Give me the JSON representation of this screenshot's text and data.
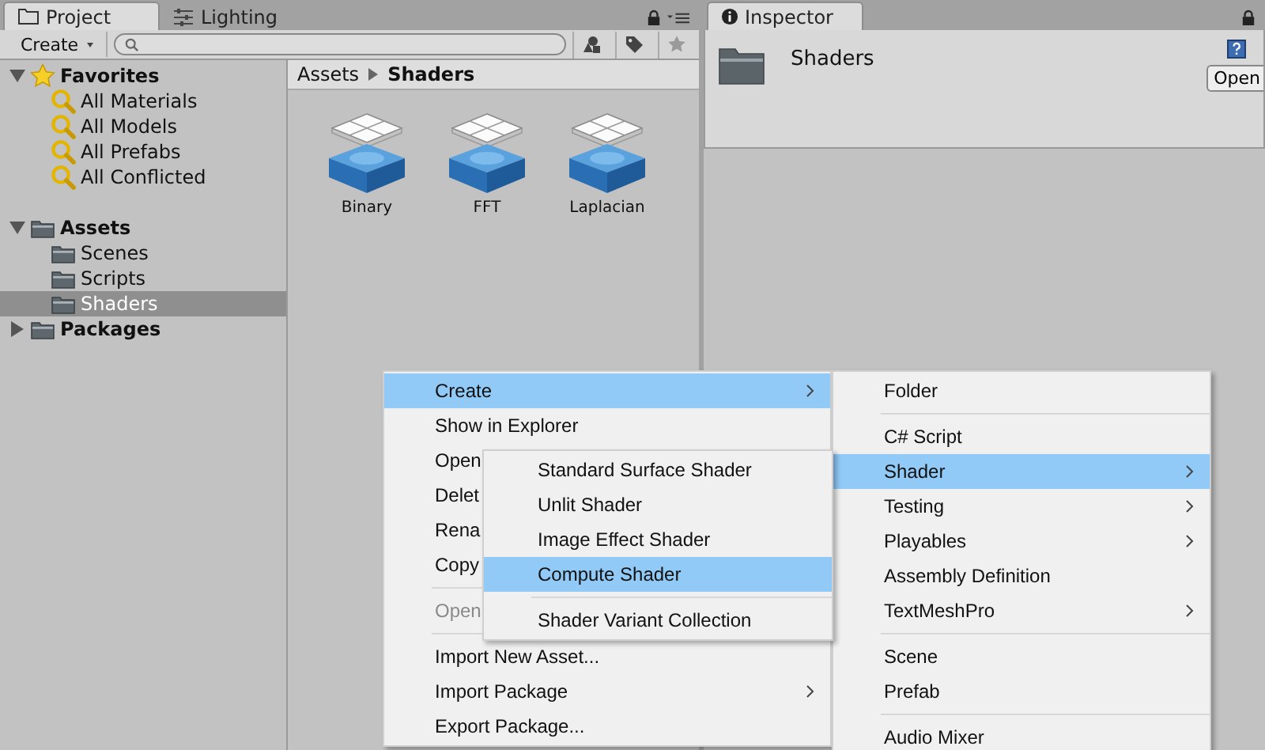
{
  "project_panel": {
    "tabs": [
      {
        "label": "Project",
        "kind": "folder",
        "selected": true
      },
      {
        "label": "Lighting",
        "kind": "sliders",
        "selected": false
      }
    ],
    "create_button": "Create",
    "tree": [
      {
        "label": "Favorites",
        "kind": "favorites",
        "expanded": true,
        "selected": false,
        "children": [
          {
            "label": "All Materials",
            "kind": "search",
            "selected": false
          },
          {
            "label": "All Models",
            "kind": "search",
            "selected": false
          },
          {
            "label": "All Prefabs",
            "kind": "search",
            "selected": false
          },
          {
            "label": "All Conflicted",
            "kind": "search",
            "selected": false
          }
        ]
      },
      {
        "label": "Assets",
        "kind": "folder",
        "expanded": true,
        "selected": false,
        "children": [
          {
            "label": "Scenes",
            "kind": "folder",
            "selected": false
          },
          {
            "label": "Scripts",
            "kind": "folder",
            "selected": false
          },
          {
            "label": "Shaders",
            "kind": "folder",
            "selected": true
          }
        ]
      },
      {
        "label": "Packages",
        "kind": "folder",
        "expanded": false,
        "selected": false
      }
    ],
    "breadcrumb": [
      "Assets",
      "Shaders"
    ],
    "assets": [
      {
        "label": "Binary"
      },
      {
        "label": "FFT"
      },
      {
        "label": "Laplacian"
      }
    ]
  },
  "inspector": {
    "tab": "Inspector",
    "title": "Shaders",
    "open_button": "Open"
  },
  "context_menu": {
    "items": [
      {
        "kind": "item",
        "label": "Create",
        "selected": true,
        "disabled": false,
        "submenu": true
      },
      {
        "kind": "item",
        "label": "Show in Explorer",
        "selected": false,
        "disabled": false,
        "submenu": false
      },
      {
        "kind": "item",
        "label": "Open",
        "selected": false,
        "disabled": false
      },
      {
        "kind": "item",
        "label": "Delet",
        "selected": false,
        "disabled": false
      },
      {
        "kind": "item",
        "label": "Rena",
        "selected": false,
        "disabled": false
      },
      {
        "kind": "item",
        "label": "Copy",
        "selected": false,
        "disabled": false
      },
      {
        "kind": "separator"
      },
      {
        "kind": "item",
        "label": "Open",
        "selected": false,
        "disabled": true,
        "submenu": false
      },
      {
        "kind": "separator"
      },
      {
        "kind": "item",
        "label": "Import New Asset...",
        "selected": false,
        "disabled": false,
        "submenu": false
      },
      {
        "kind": "item",
        "label": "Import Package",
        "selected": false,
        "disabled": false,
        "submenu": true
      },
      {
        "kind": "item",
        "label": "Export Package...",
        "selected": false,
        "disabled": false,
        "submenu": false
      }
    ]
  },
  "create_submenu": {
    "items": [
      {
        "kind": "item",
        "label": "Folder",
        "selected": false,
        "disabled": false,
        "submenu": false
      },
      {
        "kind": "separator"
      },
      {
        "kind": "item",
        "label": "C# Script",
        "selected": false,
        "disabled": false,
        "submenu": false
      },
      {
        "kind": "item",
        "label": "Shader",
        "selected": true,
        "disabled": false,
        "submenu": true
      },
      {
        "kind": "item",
        "label": "Testing",
        "selected": false,
        "disabled": false,
        "submenu": true
      },
      {
        "kind": "item",
        "label": "Playables",
        "selected": false,
        "disabled": false,
        "submenu": true
      },
      {
        "kind": "item",
        "label": "Assembly Definition",
        "selected": false,
        "disabled": false,
        "submenu": false
      },
      {
        "kind": "item",
        "label": "TextMeshPro",
        "selected": false,
        "disabled": false,
        "submenu": true
      },
      {
        "kind": "separator"
      },
      {
        "kind": "item",
        "label": "Scene",
        "selected": false,
        "disabled": false,
        "submenu": false
      },
      {
        "kind": "item",
        "label": "Prefab",
        "selected": false,
        "disabled": false,
        "submenu": false
      },
      {
        "kind": "separator"
      },
      {
        "kind": "item",
        "label": "Audio Mixer",
        "selected": false,
        "disabled": false,
        "submenu": false
      }
    ]
  },
  "shader_submenu": {
    "items": [
      {
        "kind": "item",
        "label": "Standard Surface Shader",
        "selected": false,
        "disabled": false,
        "submenu": false
      },
      {
        "kind": "item",
        "label": "Unlit Shader",
        "selected": false,
        "disabled": false,
        "submenu": false
      },
      {
        "kind": "item",
        "label": "Image Effect Shader",
        "selected": false,
        "disabled": false,
        "submenu": false
      },
      {
        "kind": "item",
        "label": "Compute Shader",
        "selected": true,
        "disabled": false,
        "submenu": false
      },
      {
        "kind": "separator"
      },
      {
        "kind": "item",
        "label": "Shader Variant Collection",
        "selected": false,
        "disabled": false,
        "submenu": false
      }
    ]
  }
}
